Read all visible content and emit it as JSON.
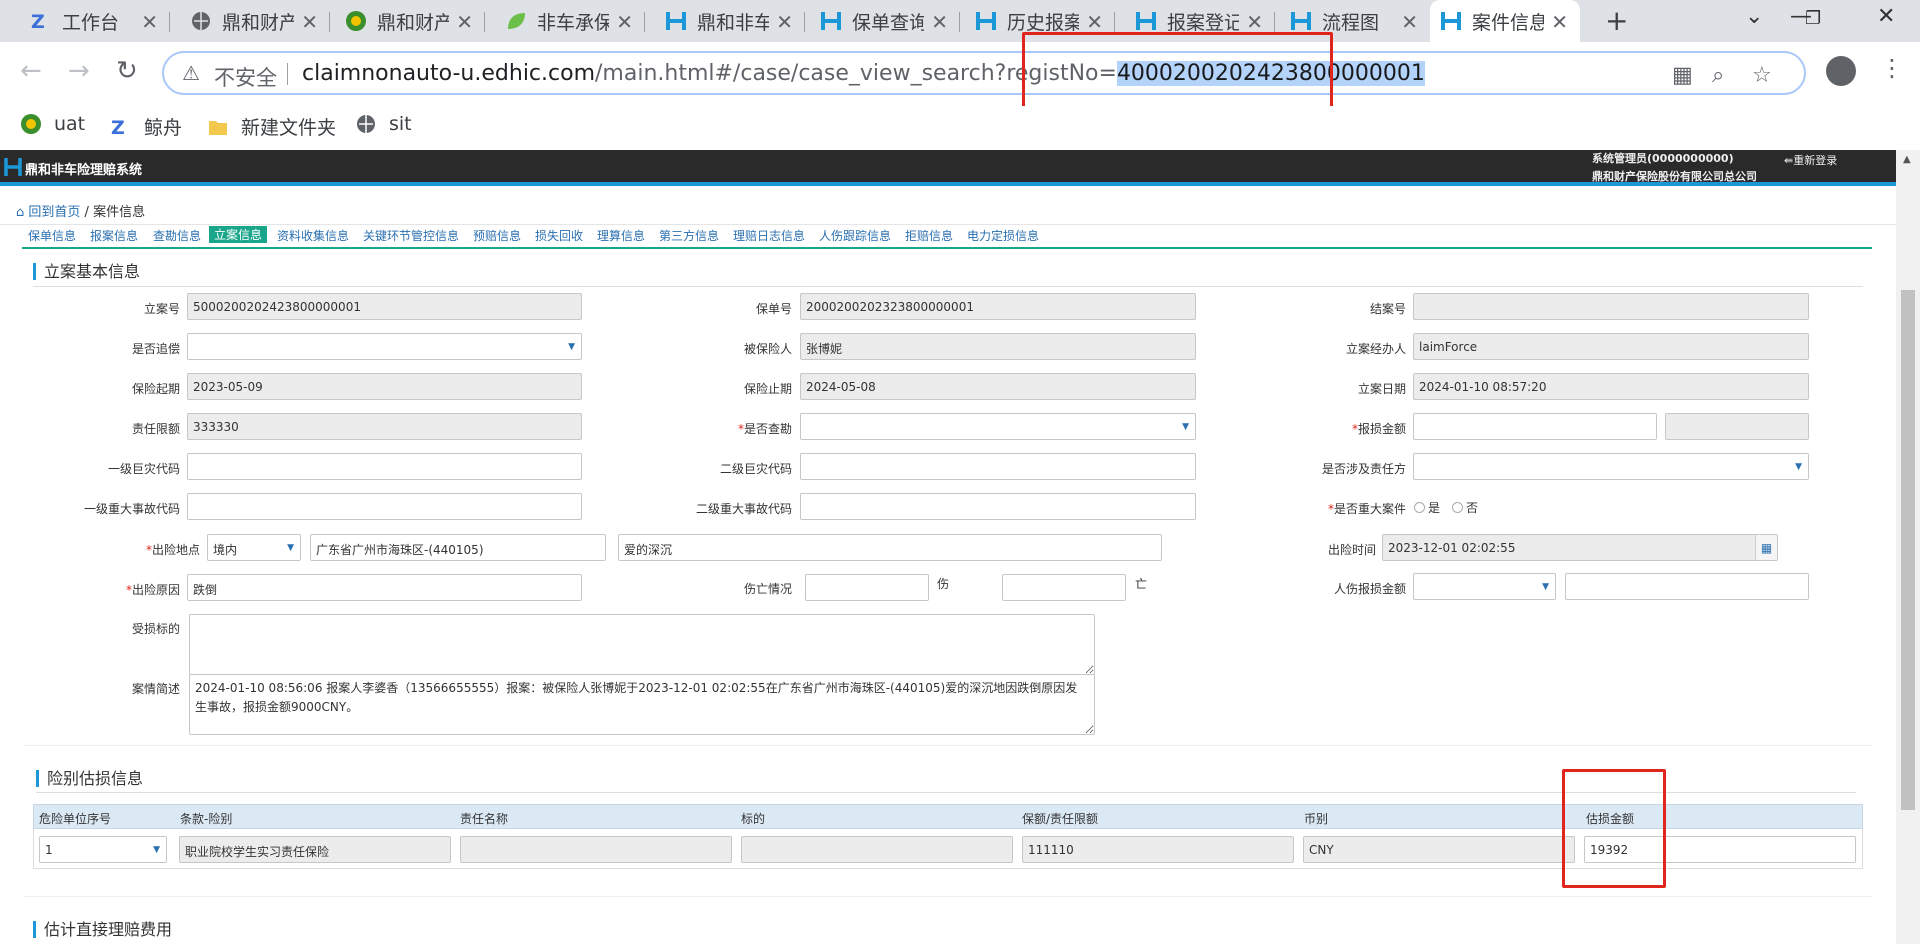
{
  "browser": {
    "tabs": [
      {
        "label": "工作台",
        "icon": "z-logo-icon"
      },
      {
        "label": "鼎和财产",
        "icon": "globe-icon"
      },
      {
        "label": "鼎和财产",
        "icon": "green-logo-icon"
      },
      {
        "label": "非车承保",
        "icon": "leaf-icon"
      },
      {
        "label": "鼎和非车",
        "icon": "h-logo-icon"
      },
      {
        "label": "保单查询",
        "icon": "h-logo-icon"
      },
      {
        "label": "历史报案",
        "icon": "h-logo-icon"
      },
      {
        "label": "报案登记",
        "icon": "h-logo-icon"
      },
      {
        "label": "流程图",
        "icon": "h-logo-icon"
      },
      {
        "label": "案件信息",
        "icon": "h-logo-icon"
      }
    ],
    "insecure_label": "不安全",
    "url_host": "claimnonauto-u.edhic.com",
    "url_path": "/main.html#/case/case_view_search?registNo=",
    "url_selected": "4000200202423800000001",
    "bookmarks": [
      {
        "label": "uat",
        "icon": "green-logo-icon"
      },
      {
        "label": "鲸舟",
        "icon": "z-logo-icon"
      },
      {
        "label": "新建文件夹",
        "icon": "folder-icon"
      },
      {
        "label": "sit",
        "icon": "globe-icon"
      }
    ]
  },
  "app": {
    "title": "鼎和非车险理赔系统",
    "user_line1": "系统管理员(0000000000)",
    "user_line2": "鼎和财产保险股份有限公司总公司",
    "relogin": "重新登录",
    "breadcrumb_home": "回到首页",
    "breadcrumb_sep": " / ",
    "breadcrumb_current": "案件信息",
    "subnav": [
      "保单信息",
      "报案信息",
      "查勘信息",
      "立案信息",
      "资料收集信息",
      "关键环节管控信息",
      "预赔信息",
      "损失回收",
      "理算信息",
      "第三方信息",
      "理赔日志信息",
      "人伤跟踪信息",
      "拒赔信息",
      "电力定损信息"
    ],
    "subnav_active_index": 3
  },
  "case_basic": {
    "section_title": "立案基本信息",
    "fields": {
      "regist_no_label": "立案号",
      "regist_no": "5000200202423800000001",
      "policy_no_label": "保单号",
      "policy_no": "2000200202323800000001",
      "close_no_label": "结案号",
      "close_no": "",
      "recovery_label": "是否追偿",
      "recovery": "",
      "insured_label": "被保险人",
      "insured": "张博妮",
      "handler_label": "立案经办人",
      "handler": "laimForce",
      "start_label": "保险起期",
      "start": "2023-05-09",
      "end_label": "保险止期",
      "end": "2024-05-08",
      "regist_date_label": "立案日期",
      "regist_date": "2024-01-10 08:57:20",
      "liability_label": "责任限额",
      "liability": "333330",
      "survey_label": "是否查勘",
      "survey": "",
      "report_amount_label": "报损金额",
      "report_amount": "",
      "report_amount2": "",
      "l1_disaster_label": "一级巨灾代码",
      "l1_disaster": "",
      "l2_disaster_label": "二级巨灾代码",
      "l2_disaster": "",
      "responsible_label": "是否涉及责任方",
      "responsible": "",
      "l1_major_label": "一级重大事故代码",
      "l1_major": "",
      "l2_major_label": "二级重大事故代码",
      "l2_major": "",
      "major_case_label": "是否重大案件",
      "major_yes": "是",
      "major_no": "否",
      "loss_place_label": "出险地点",
      "loss_place_scope": "境内",
      "loss_place_region": "广东省广州市海珠区-(440105)",
      "loss_place_detail": "爱的深沉",
      "loss_time_label": "出险时间",
      "loss_time": "2023-12-01 02:02:55",
      "loss_cause_label": "出险原因",
      "loss_cause": "跌倒",
      "casualty_label": "伤亡情况",
      "injured_unit": "伤",
      "dead_unit": "亡",
      "injured": "",
      "dead": "",
      "injury_amount_label": "人伤报损金额",
      "injury_amount_currency": "",
      "injury_amount": "",
      "damaged_object_label": "受损标的",
      "damaged_object": "",
      "summary_label": "案情简述",
      "summary": "2024-01-10 08:56:06 报案人李婆香（13566655555）报案：被保险人张博妮于2023-12-01 02:02:55在广东省广州市海珠区-(440105)爱的深沉地因跌倒原因发生事故，报损金额9000CNY。"
    }
  },
  "risk_estimate": {
    "section_title": "险别估损信息",
    "columns": [
      "危险单位序号",
      "条款-险别",
      "责任名称",
      "标的",
      "保额/责任限额",
      "币别",
      "估损金额"
    ],
    "rows": [
      {
        "unit_no": "1",
        "clause": "职业院校学生实习责任保险",
        "duty": "",
        "target": "",
        "amount": "111110",
        "currency": "CNY",
        "estimate": "19392"
      }
    ]
  },
  "direct_fee": {
    "section_title": "估计直接理赔费用"
  },
  "colors": {
    "accent": "#1aa68a",
    "header": "#2a2a2a",
    "highlight": "#e0251e",
    "link": "#2a6fb0"
  }
}
